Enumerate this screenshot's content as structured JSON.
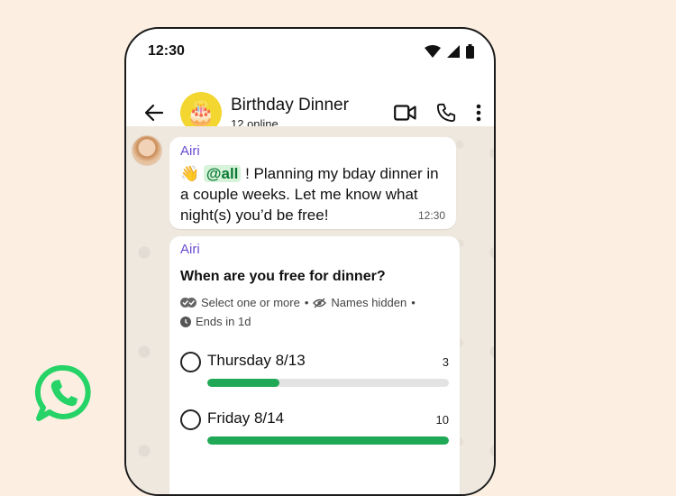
{
  "status_bar": {
    "time": "12:30"
  },
  "chat_header": {
    "group_name": "Birthday Dinner",
    "online_status": "12 online",
    "avatar_emoji": "🎂"
  },
  "messages": [
    {
      "sender": "Airi",
      "emoji": "👋",
      "mention": "@all",
      "text": " ! Planning my bday dinner in a couple weeks. Let me know what night(s) you’d be free!",
      "time": "12:30"
    }
  ],
  "poll": {
    "sender": "Airi",
    "question": "When are you free for dinner?",
    "meta_select": "Select one or more",
    "meta_names": "Names hidden",
    "meta_ends": "Ends in 1d",
    "options": [
      {
        "label": "Thursday 8/13",
        "count": "3",
        "fraction": 0.3
      },
      {
        "label": "Friday 8/14",
        "count": "10",
        "fraction": 1.0
      }
    ]
  },
  "colors": {
    "brand_green": "#25D366",
    "poll_bar": "#1fa855",
    "sender_name": "#6a4bd1",
    "background": "#fcefe2"
  }
}
